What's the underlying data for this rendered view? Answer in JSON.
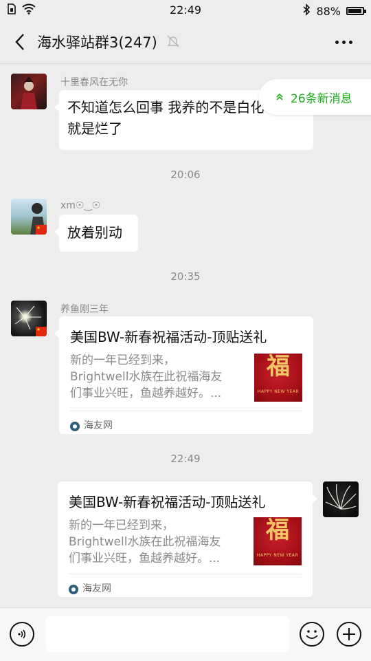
{
  "status_bar": {
    "time": "22:49",
    "battery_percent_text": "88%",
    "battery_level": 0.88,
    "icons": [
      "sim-icon",
      "wifi-icon",
      "bluetooth-icon",
      "battery-icon"
    ]
  },
  "header": {
    "title": "海水驿站群3(247)",
    "icons": [
      "back-arrow-icon",
      "mute-bell-icon",
      "more-dots-icon"
    ]
  },
  "new_messages": {
    "label": "26条新消息",
    "icon": "double-chevron-up-icon",
    "color": "#1aad19"
  },
  "messages": [
    {
      "sender": "十里春风在无你",
      "lines": [
        "不知道怎么回事  我养的不是白化",
        "就是烂了"
      ]
    },
    {
      "timestamp": "20:06"
    },
    {
      "sender": "xm☉‿☉",
      "text": "放着别动"
    },
    {
      "timestamp": "20:35"
    },
    {
      "sender": "养鱼刚三年",
      "card": {
        "title": "美国BW-新春祝福活动-顶贴送礼",
        "desc_lines": [
          "新的一年已经到来，",
          "Brightwell水族在此祝福海友",
          "们事业兴旺，鱼越养越好。..."
        ],
        "thumb_char": "福",
        "thumb_sub": "HAPPY NEW YEAR",
        "source": "海友网"
      }
    },
    {
      "timestamp": "22:49"
    },
    {
      "self": true,
      "card": {
        "title": "美国BW-新春祝福活动-顶贴送礼",
        "desc_lines": [
          "新的一年已经到来，",
          "Brightwell水族在此祝福海友",
          "们事业兴旺，鱼越养越好。..."
        ],
        "thumb_char": "福",
        "thumb_sub": "HAPPY NEW YEAR",
        "source": "海友网"
      }
    }
  ],
  "input_bar": {
    "placeholder": "",
    "icons": [
      "voice-icon",
      "emoji-icon",
      "plus-icon"
    ]
  },
  "colors": {
    "background": "#ededed",
    "bubble": "#ffffff",
    "accent_green": "#1aad19",
    "meta_text": "#8a8a8a"
  }
}
